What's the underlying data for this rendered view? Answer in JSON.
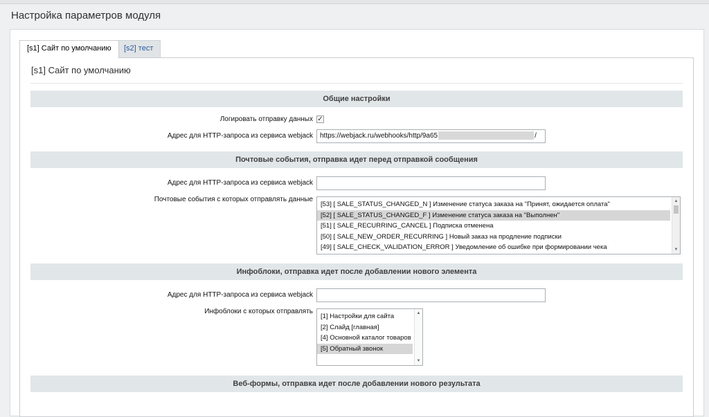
{
  "page": {
    "title": "Настройка параметров модуля"
  },
  "tabs": [
    {
      "label": "[s1] Сайт по умолчанию",
      "active": true
    },
    {
      "label": "[s2] тест",
      "active": false
    }
  ],
  "panel": {
    "heading": "[s1] Сайт по умолчанию"
  },
  "sections": {
    "general": {
      "title": "Общие настройки",
      "log_label": "Логировать отправку данных",
      "log_checked": true,
      "url_label": "Адрес для HTTP-запроса из сервиса webjack",
      "url_value_start": "https://webjack.ru/webhooks/http/9a65",
      "url_value_end": "/"
    },
    "mail": {
      "title": "Почтовые события, отправка идет перед отправкой сообщения",
      "url_label": "Адрес для HTTP-запроса из сервиса webjack",
      "url_value": "",
      "events_label": "Почтовые события с которых отправлять данные",
      "events": [
        {
          "text": "[53] [ SALE_STATUS_CHANGED_N ] Изменение статуса заказа на \"Принят, ожидается оплата\"",
          "selected": false
        },
        {
          "text": "[52] [ SALE_STATUS_CHANGED_F ] Изменение статуса заказа на \"Выполнен\"",
          "selected": true
        },
        {
          "text": "[51] [ SALE_RECURRING_CANCEL ] Подписка отменена",
          "selected": false
        },
        {
          "text": "[50] [ SALE_NEW_ORDER_RECURRING ] Новый заказ на продление подписки",
          "selected": false
        },
        {
          "text": "[49] [ SALE_CHECK_VALIDATION_ERROR ] Уведомление об ошибке при формировании чека",
          "selected": false
        }
      ]
    },
    "iblock": {
      "title": "Инфоблоки, отправка идет после добавлении нового элемента",
      "url_label": "Адрес для HTTP-запроса из сервиса webjack",
      "url_value": "",
      "blocks_label": "Инфоблоки с которых отправлять",
      "blocks": [
        {
          "text": "[1] Настройки для сайта",
          "selected": false
        },
        {
          "text": "[2] Слайд [главная]",
          "selected": false
        },
        {
          "text": "[4] Основной каталог товаров",
          "selected": false
        },
        {
          "text": "[5] Обратный звонок",
          "selected": true
        }
      ]
    },
    "webforms": {
      "title": "Веб-формы, отправка идет после добавлении нового результата"
    }
  },
  "icons": {
    "checkmark": "check-icon",
    "scroll_up": "arrow-up-icon",
    "scroll_down": "arrow-down-icon"
  }
}
